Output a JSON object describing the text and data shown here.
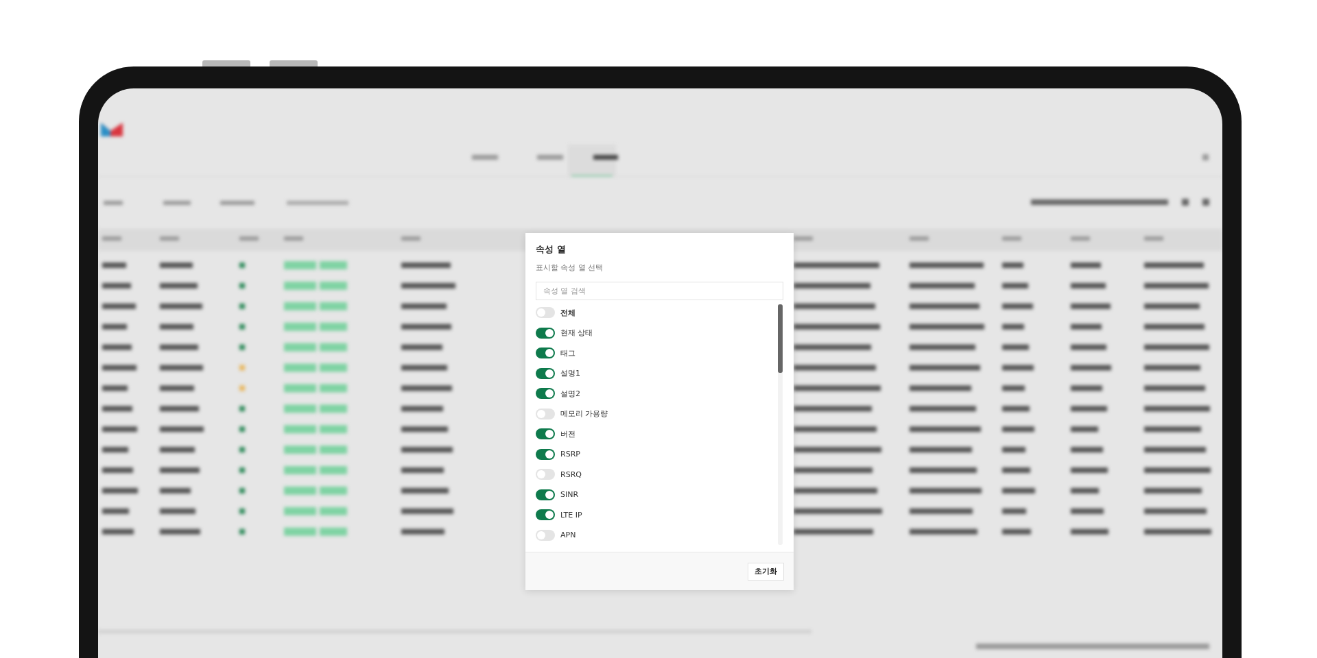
{
  "dialog": {
    "title": "속성 열",
    "subtitle": "표시할 속성 열 선택",
    "search": {
      "placeholder": "속성 열 검색"
    },
    "columns": [
      {
        "label": "전체",
        "on": false,
        "kind": "all"
      },
      {
        "label": "현재 상태",
        "on": true,
        "kind": "column"
      },
      {
        "label": "태그",
        "on": true,
        "kind": "column"
      },
      {
        "label": "설명1",
        "on": true,
        "kind": "column"
      },
      {
        "label": "설명2",
        "on": true,
        "kind": "column"
      },
      {
        "label": "메모리 가용량",
        "on": false,
        "kind": "column"
      },
      {
        "label": "버전",
        "on": true,
        "kind": "column"
      },
      {
        "label": "RSRP",
        "on": true,
        "kind": "column"
      },
      {
        "label": "RSRQ",
        "on": false,
        "kind": "column"
      },
      {
        "label": "SINR",
        "on": true,
        "kind": "column"
      },
      {
        "label": "LTE IP",
        "on": true,
        "kind": "column"
      },
      {
        "label": "APN",
        "on": false,
        "kind": "column"
      }
    ],
    "reset_button": "초기화"
  }
}
